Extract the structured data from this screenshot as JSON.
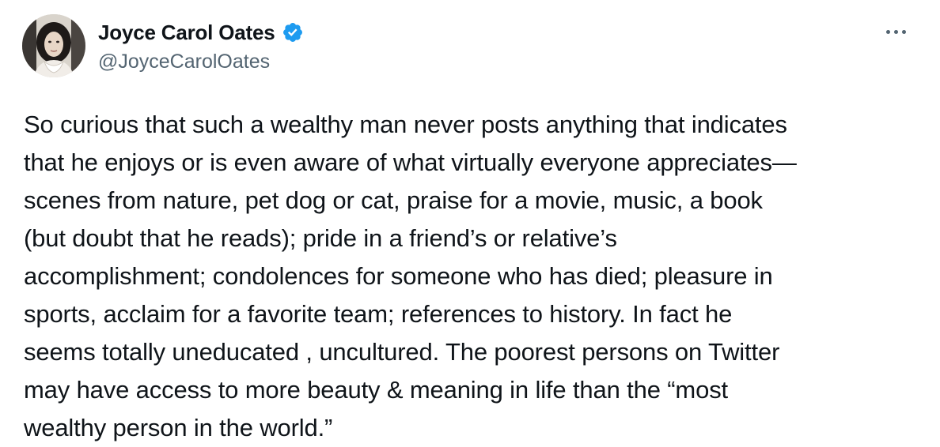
{
  "author": {
    "display_name": "Joyce Carol Oates",
    "handle": "@JoyceCarolOates",
    "verified": true,
    "avatar_icon": "profile-photo"
  },
  "menu": {
    "more_icon": "more-horizontal-icon"
  },
  "tweet": {
    "text": "So curious that such a wealthy man never posts anything that indicates\nthat he enjoys or is even aware of what virtually everyone appreciates—\nscenes from nature, pet dog or cat, praise for a movie, music, a book\n(but doubt that he reads); pride in a friend’s or relative’s\naccomplishment; condolences for someone who has died; pleasure in\nsports, acclaim for a favorite team;  references to history.  In fact he\nseems totally uneducated , uncultured. The poorest persons on Twitter\nmay have access to more beauty & meaning in life than the “most\nwealthy person in the world.”"
  },
  "colors": {
    "verified_badge": "#1d9bf0",
    "primary_text": "#0f1419",
    "secondary_text": "#536471"
  }
}
